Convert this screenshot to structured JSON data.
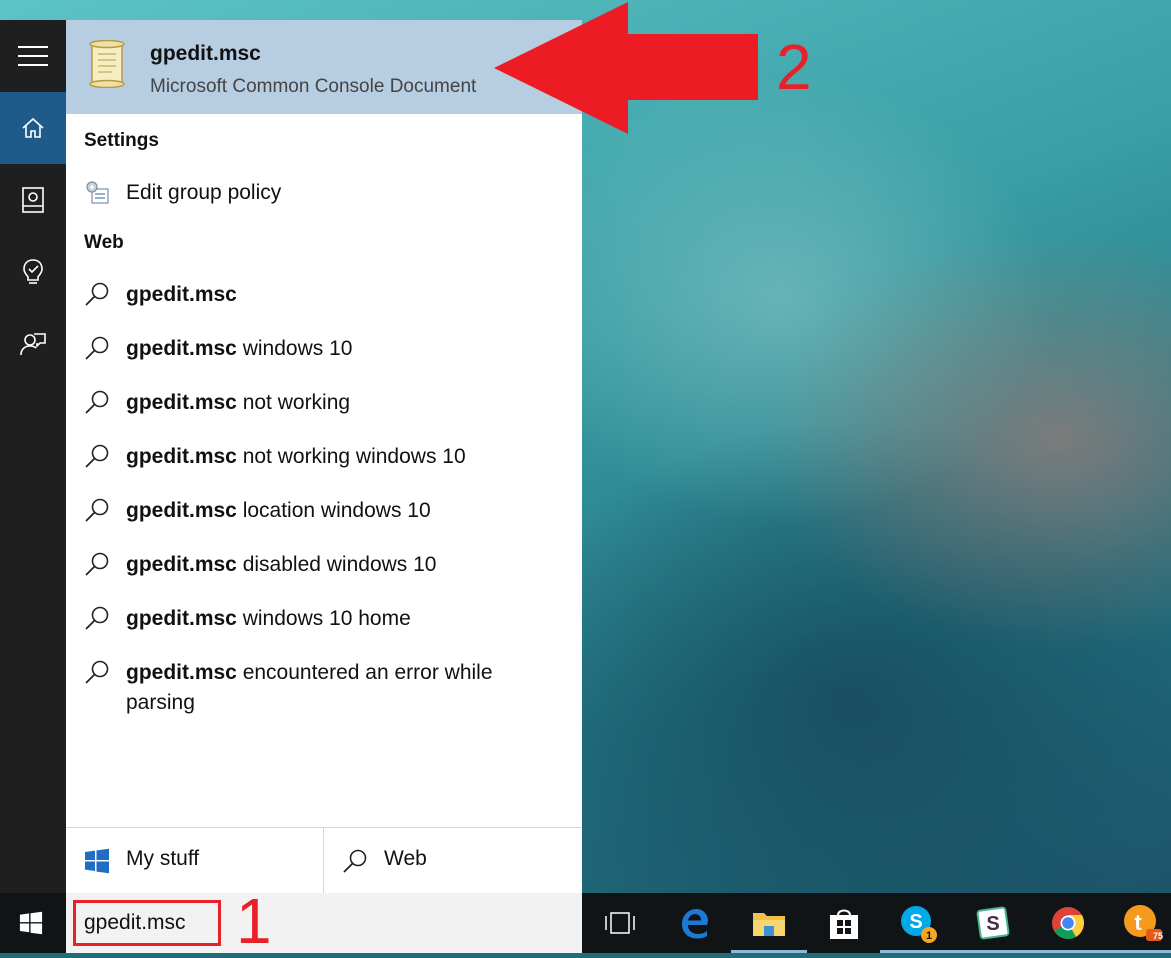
{
  "best_match": {
    "title": "gpedit.msc",
    "subtitle": "Microsoft Common Console Document"
  },
  "sections": {
    "settings": "Settings",
    "web": "Web"
  },
  "settings_items": [
    {
      "label": "Edit group policy"
    }
  ],
  "web_items": [
    {
      "bold": "gpedit.msc",
      "rest": ""
    },
    {
      "bold": "gpedit.msc",
      "rest": " windows 10"
    },
    {
      "bold": "gpedit.msc",
      "rest": " not working"
    },
    {
      "bold": "gpedit.msc",
      "rest": " not working windows 10"
    },
    {
      "bold": "gpedit.msc",
      "rest": " location windows 10"
    },
    {
      "bold": "gpedit.msc",
      "rest": " disabled windows 10"
    },
    {
      "bold": "gpedit.msc",
      "rest": " windows 10 home"
    },
    {
      "bold": "gpedit.msc",
      "rest": " encountered an error while parsing"
    }
  ],
  "bottom_tabs": {
    "my_stuff": "My stuff",
    "web": "Web"
  },
  "search": {
    "value": "gpedit.msc"
  },
  "annotations": {
    "one": "1",
    "two": "2"
  },
  "taskbar": {
    "skype_badge": "1",
    "app_badge": "75"
  },
  "colors": {
    "accent": "#1e5b8a",
    "best_match_bg": "#b6cde2",
    "annotation_red": "#e8202a"
  }
}
